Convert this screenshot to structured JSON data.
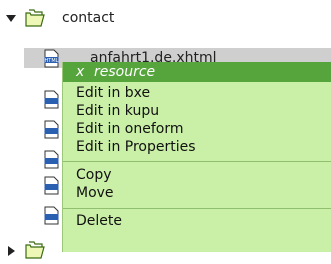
{
  "tree": {
    "parent_folder": {
      "label": "contact",
      "expanded": true
    },
    "selected_file": {
      "label": "anfahrt1.de.xhtml"
    },
    "file_icon_badge": "HTML",
    "child_icon_count": 5,
    "sibling_folder": {
      "label": "",
      "expanded": false
    }
  },
  "context_menu": {
    "close_label": "x",
    "title": "resource",
    "items": [
      {
        "label": "Edit in bxe"
      },
      {
        "label": "Edit in kupu"
      },
      {
        "label": "Edit in oneform"
      },
      {
        "label": "Edit in Properties"
      },
      {
        "label": "Copy"
      },
      {
        "label": "Move"
      },
      {
        "label": "Delete"
      }
    ]
  },
  "colors": {
    "menu_background": "#c9f0a6",
    "menu_header": "#55a43c",
    "selection": "#cfcfcf",
    "folder_fill": "#eef7b6",
    "folder_stroke": "#3a6b12"
  }
}
